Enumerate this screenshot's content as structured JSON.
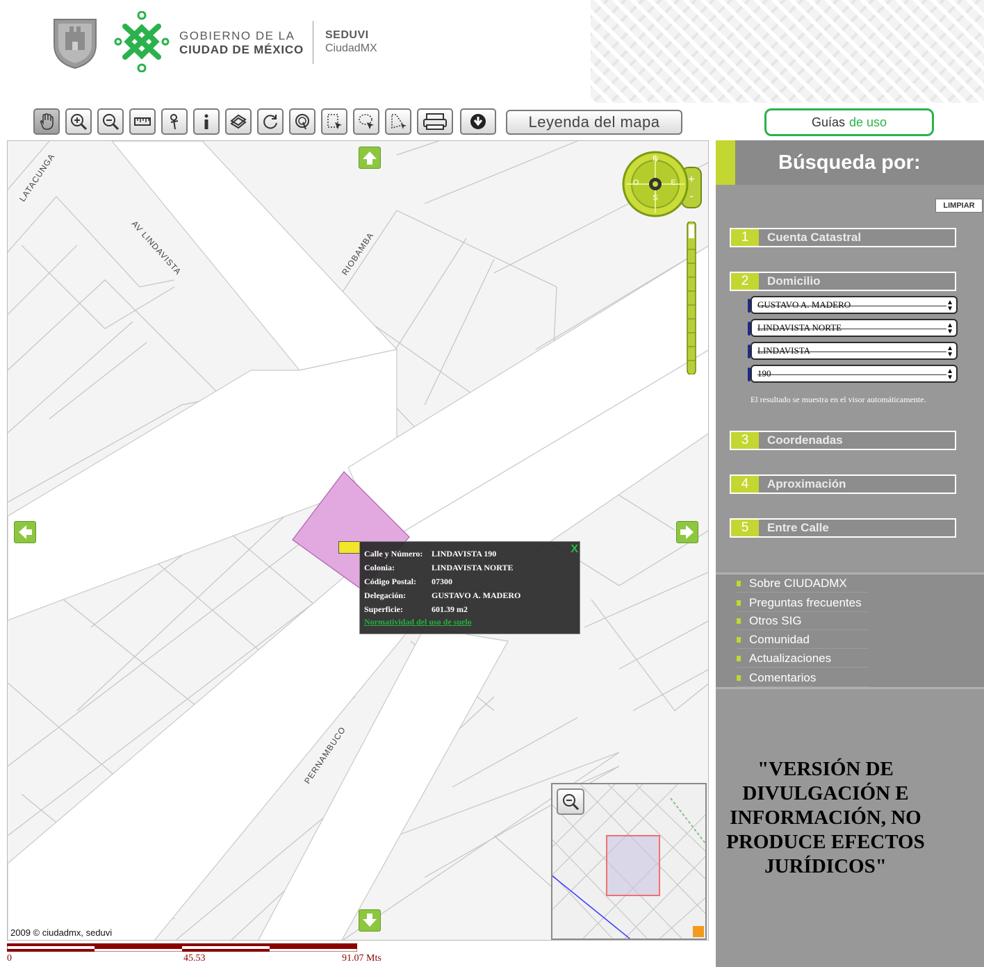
{
  "header": {
    "gov_line1": "GOBIERNO DE LA",
    "gov_line2": "CIUDAD DE MÉXICO",
    "agency_line1": "SEDUVI",
    "agency_line2": "CiudadMX",
    "brand_green": "#2bb24c"
  },
  "toolbar": {
    "tools": [
      "hand-icon",
      "zoom-in-icon",
      "zoom-out-icon",
      "ruler-icon",
      "pin-icon",
      "info-icon",
      "layers-icon",
      "refresh-icon",
      "circle-select-icon",
      "rect-select-icon",
      "lasso-select-icon",
      "polygon-select-icon",
      "print-icon",
      "download-icon"
    ],
    "legend_label": "Leyenda del mapa",
    "guides_label_1": "Guías",
    "guides_label_2": "de uso"
  },
  "map": {
    "streets": [
      "LATACUNGA",
      "AV LINDAVISTA",
      "RIOBAMBA",
      "PERNAMBUCO"
    ],
    "compass": {
      "n": "N",
      "s": "S",
      "e": "E",
      "o": "O"
    },
    "popup": {
      "rows": [
        {
          "key": "Calle y Número:",
          "value": "LINDAVISTA 190"
        },
        {
          "key": "Colonia:",
          "value": "LINDAVISTA NORTE"
        },
        {
          "key": "Código Postal:",
          "value": "07300"
        },
        {
          "key": "Delegación:",
          "value": "GUSTAVO A. MADERO"
        },
        {
          "key": "Superficie:",
          "value": "601.39 m2"
        }
      ],
      "link": "Normatividad del uso de suelo",
      "close": "X"
    },
    "copyright": "2009 © ciudadmx, seduvi",
    "parcel_color": "#e2a8e0",
    "scale": {
      "l0": "0",
      "l1": "45.53",
      "l2": "91.07 Mts",
      "color": "#8b0000"
    }
  },
  "panel": {
    "title": "Búsqueda por:",
    "clear": "LIMPIAR",
    "sections": [
      {
        "num": "1",
        "label": "Cuenta Catastral"
      },
      {
        "num": "2",
        "label": "Domicilio"
      },
      {
        "num": "3",
        "label": "Coordenadas"
      },
      {
        "num": "4",
        "label": "Aproximación"
      },
      {
        "num": "5",
        "label": "Entre Calle"
      }
    ],
    "selects": [
      "GUSTAVO A. MADERO",
      "LINDAVISTA NORTE",
      "LINDAVISTA",
      "190"
    ],
    "result_note": "El resultado se muestra en el visor automáticamente.",
    "links": [
      "Sobre CIUDADMX",
      "Preguntas frecuentes",
      "Otros SIG",
      "Comunidad",
      "Actualizaciones",
      "Comentarios"
    ],
    "disclaimer": "\"VERSIÓN DE DIVULGACIÓN E INFORMACIÓN, NO PRODUCE EFECTOS JURÍDICOS\"",
    "accent": "#c4d631"
  }
}
